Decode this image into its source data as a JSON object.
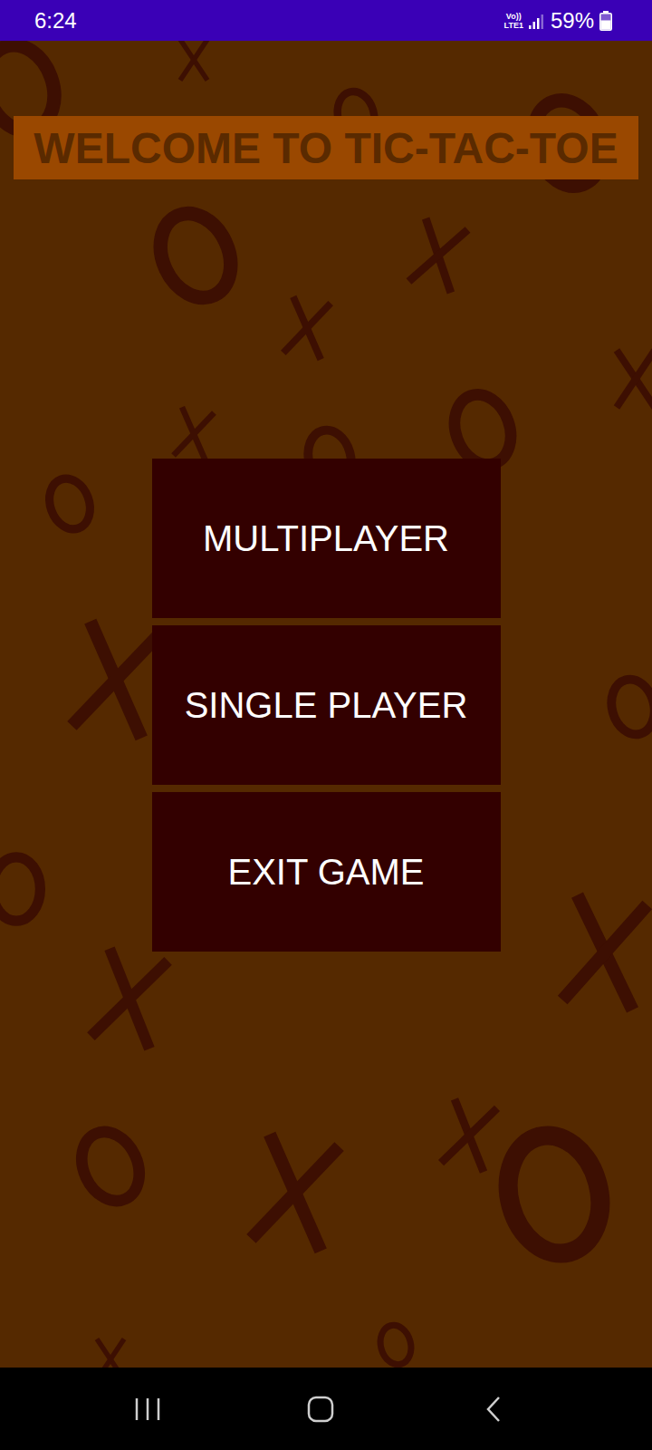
{
  "status_bar": {
    "time": "6:24",
    "volte": "Vo))",
    "network": "LTE1",
    "signal": {
      "level": 0.75
    },
    "battery": {
      "reading": "59%",
      "level": 0.59
    }
  },
  "title": "WELCOME TO TIC-TAC-TOE",
  "menu": [
    {
      "label": "MULTIPLAYER"
    },
    {
      "label": "SINGLE PLAYER"
    },
    {
      "label": "EXIT GAME"
    }
  ],
  "nav_bar": {
    "buttons": [
      {
        "name": "recent-apps"
      },
      {
        "name": "home"
      },
      {
        "name": "back"
      }
    ]
  }
}
